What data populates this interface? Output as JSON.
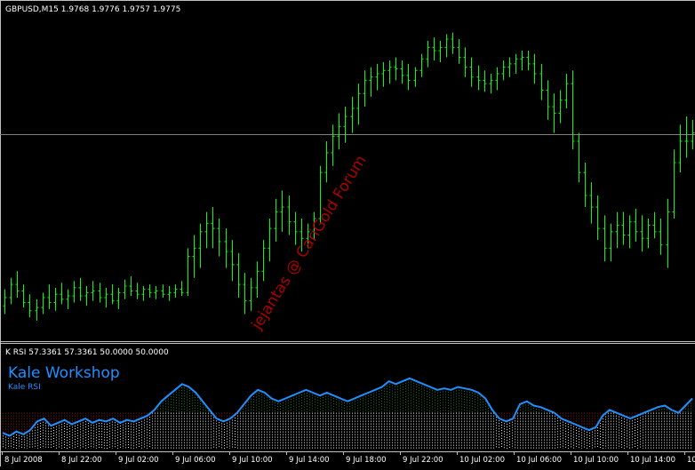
{
  "main_chart": {
    "header": "GBPUSD,M15  1.9768 1.9776 1.9757 1.9775",
    "watermark": "jejantas @ CariGold Forum",
    "bar_color": "#00ff00",
    "bid_line_color": "#808080",
    "ohlc_bars": [
      [
        1.9695,
        1.9705,
        1.969,
        1.97
      ],
      [
        1.97,
        1.9712,
        1.9696,
        1.9708
      ],
      [
        1.9708,
        1.9716,
        1.97,
        1.9704
      ],
      [
        1.9704,
        1.9708,
        1.9694,
        1.9697
      ],
      [
        1.9697,
        1.9702,
        1.9688,
        1.9692
      ],
      [
        1.9692,
        1.9699,
        1.9686,
        1.9694
      ],
      [
        1.9694,
        1.9703,
        1.969,
        1.97
      ],
      [
        1.97,
        1.9708,
        1.9693,
        1.9697
      ],
      [
        1.9697,
        1.9706,
        1.9692,
        1.9702
      ],
      [
        1.9702,
        1.9709,
        1.9696,
        1.9699
      ],
      [
        1.9699,
        1.9705,
        1.9693,
        1.9701
      ],
      [
        1.9701,
        1.971,
        1.9697,
        1.9706
      ],
      [
        1.9706,
        1.9712,
        1.9698,
        1.9701
      ],
      [
        1.9701,
        1.9707,
        1.9695,
        1.9703
      ],
      [
        1.9703,
        1.971,
        1.9698,
        1.9704
      ],
      [
        1.9704,
        1.9709,
        1.9697,
        1.97
      ],
      [
        1.97,
        1.9706,
        1.9694,
        1.9702
      ],
      [
        1.9702,
        1.9708,
        1.9696,
        1.9698
      ],
      [
        1.9698,
        1.9706,
        1.9693,
        1.9703
      ],
      [
        1.9703,
        1.9711,
        1.9699,
        1.9707
      ],
      [
        1.9707,
        1.9713,
        1.9701,
        1.9704
      ],
      [
        1.9704,
        1.9709,
        1.9699,
        1.9702
      ],
      [
        1.9702,
        1.9707,
        1.9698,
        1.9705
      ],
      [
        1.9705,
        1.9708,
        1.97,
        1.9703
      ],
      [
        1.9703,
        1.9707,
        1.9699,
        1.9704
      ],
      [
        1.9704,
        1.9708,
        1.97,
        1.9702
      ],
      [
        1.9702,
        1.9707,
        1.9698,
        1.9703
      ],
      [
        1.9703,
        1.9708,
        1.97,
        1.9705
      ],
      [
        1.9705,
        1.971,
        1.9701,
        1.9703
      ],
      [
        1.9703,
        1.973,
        1.9701,
        1.9725
      ],
      [
        1.9725,
        1.9738,
        1.9712,
        1.973
      ],
      [
        1.973,
        1.9745,
        1.9718,
        1.974
      ],
      [
        1.974,
        1.9752,
        1.973,
        1.9745
      ],
      [
        1.9745,
        1.9755,
        1.973,
        1.9742
      ],
      [
        1.9742,
        1.9748,
        1.9725,
        1.9734
      ],
      [
        1.9734,
        1.9742,
        1.9718,
        1.9728
      ],
      [
        1.9728,
        1.9735,
        1.971,
        1.972
      ],
      [
        1.972,
        1.9727,
        1.97,
        1.9708
      ],
      [
        1.9708,
        1.9715,
        1.969,
        1.9698
      ],
      [
        1.9698,
        1.9712,
        1.9692,
        1.9706
      ],
      [
        1.9706,
        1.9722,
        1.97,
        1.9716
      ],
      [
        1.9716,
        1.9735,
        1.971,
        1.973
      ],
      [
        1.973,
        1.9748,
        1.9722,
        1.9742
      ],
      [
        1.9742,
        1.976,
        1.9734,
        1.9752
      ],
      [
        1.9752,
        1.9765,
        1.974,
        1.9755
      ],
      [
        1.9755,
        1.9762,
        1.9738,
        1.9746
      ],
      [
        1.9746,
        1.9752,
        1.9732,
        1.974
      ],
      [
        1.974,
        1.9748,
        1.9728,
        1.9736
      ],
      [
        1.9736,
        1.9745,
        1.973,
        1.974
      ],
      [
        1.974,
        1.9752,
        1.9735,
        1.9748
      ],
      [
        1.9748,
        1.978,
        1.9745,
        1.9776
      ],
      [
        1.9776,
        1.9795,
        1.977,
        1.9788
      ],
      [
        1.9788,
        1.9805,
        1.978,
        1.9798
      ],
      [
        1.9798,
        1.9812,
        1.979,
        1.9804
      ],
      [
        1.9804,
        1.9816,
        1.9794,
        1.981
      ],
      [
        1.981,
        1.9822,
        1.98,
        1.9815
      ],
      [
        1.9815,
        1.983,
        1.9805,
        1.9824
      ],
      [
        1.9824,
        1.9838,
        1.9816,
        1.9832
      ],
      [
        1.9832,
        1.984,
        1.9822,
        1.9834
      ],
      [
        1.9834,
        1.9842,
        1.9826,
        1.9836
      ],
      [
        1.9836,
        1.9843,
        1.9828,
        1.9838
      ],
      [
        1.9838,
        1.9844,
        1.983,
        1.984
      ],
      [
        1.984,
        1.9846,
        1.9832,
        1.9839
      ],
      [
        1.9839,
        1.9844,
        1.983,
        1.9835
      ],
      [
        1.9835,
        1.9842,
        1.9826,
        1.9832
      ],
      [
        1.9832,
        1.984,
        1.9828,
        1.9838
      ],
      [
        1.9838,
        1.9848,
        1.9834,
        1.9845
      ],
      [
        1.9845,
        1.9856,
        1.984,
        1.9852
      ],
      [
        1.9852,
        1.9858,
        1.9844,
        1.985
      ],
      [
        1.985,
        1.9856,
        1.9843,
        1.9852
      ],
      [
        1.9852,
        1.986,
        1.9846,
        1.9857
      ],
      [
        1.9857,
        1.9861,
        1.9848,
        1.9852
      ],
      [
        1.9852,
        1.9857,
        1.9842,
        1.9846
      ],
      [
        1.9846,
        1.9852,
        1.9834,
        1.984
      ],
      [
        1.984,
        1.9846,
        1.9828,
        1.9834
      ],
      [
        1.9834,
        1.9841,
        1.9826,
        1.9832
      ],
      [
        1.9832,
        1.9838,
        1.9825,
        1.983
      ],
      [
        1.983,
        1.9836,
        1.9824,
        1.9832
      ],
      [
        1.9832,
        1.984,
        1.9826,
        1.9836
      ],
      [
        1.9836,
        1.9844,
        1.9832,
        1.984
      ],
      [
        1.984,
        1.9846,
        1.9834,
        1.9842
      ],
      [
        1.9842,
        1.9848,
        1.9836,
        1.9845
      ],
      [
        1.9845,
        1.985,
        1.9838,
        1.9846
      ],
      [
        1.9846,
        1.985,
        1.9838,
        1.9842
      ],
      [
        1.9842,
        1.9848,
        1.983,
        1.9836
      ],
      [
        1.9836,
        1.9842,
        1.982,
        1.9826
      ],
      [
        1.9826,
        1.9832,
        1.9808,
        1.9816
      ],
      [
        1.9816,
        1.9824,
        1.98,
        1.9812
      ],
      [
        1.9812,
        1.9826,
        1.9806,
        1.982
      ],
      [
        1.982,
        1.9836,
        1.9815,
        1.983
      ],
      [
        1.983,
        1.9838,
        1.979,
        1.9795
      ],
      [
        1.9795,
        1.98,
        1.977,
        1.9776
      ],
      [
        1.9776,
        1.9782,
        1.9755,
        1.9762
      ],
      [
        1.9762,
        1.977,
        1.9745,
        1.9755
      ],
      [
        1.9755,
        1.9762,
        1.9735,
        1.9742
      ],
      [
        1.9742,
        1.975,
        1.9722,
        1.973
      ],
      [
        1.973,
        1.9745,
        1.9722,
        1.974
      ],
      [
        1.974,
        1.9752,
        1.973,
        1.9744
      ],
      [
        1.9744,
        1.9752,
        1.9732,
        1.9738
      ],
      [
        1.9738,
        1.975,
        1.973,
        1.9746
      ],
      [
        1.9746,
        1.9754,
        1.9734,
        1.974
      ],
      [
        1.974,
        1.975,
        1.9728,
        1.9736
      ],
      [
        1.9736,
        1.9748,
        1.973,
        1.9744
      ],
      [
        1.9744,
        1.9752,
        1.9736,
        1.974
      ],
      [
        1.974,
        1.9748,
        1.9726,
        1.9732
      ],
      [
        1.9732,
        1.976,
        1.9718,
        1.9752
      ],
      [
        1.9752,
        1.979,
        1.9748,
        1.9782
      ],
      [
        1.9782,
        1.9805,
        1.9776,
        1.9795
      ],
      [
        1.9795,
        1.981,
        1.9785,
        1.9795
      ],
      [
        1.9795,
        1.9808,
        1.979,
        1.98
      ]
    ]
  },
  "indicator": {
    "header": "K RSI 57.3361 57.3361 50.0000 50.0000",
    "title": "Kale Workshop",
    "subtitle": "Kale RSI",
    "line_color": "#1e90ff",
    "upper_fill_color": "#1a7a1a",
    "lower_fill_color": "#8b1010",
    "base_dot_color": "#e6e6e6",
    "level": 50,
    "range": [
      25,
      90
    ],
    "rsi_values": [
      36,
      34,
      37,
      35,
      38,
      44,
      46,
      41,
      43,
      45,
      42,
      44,
      46,
      43,
      45,
      44,
      46,
      43,
      45,
      44,
      46,
      48,
      52,
      58,
      62,
      66,
      70,
      68,
      64,
      58,
      52,
      46,
      44,
      46,
      50,
      56,
      62,
      66,
      64,
      60,
      58,
      60,
      62,
      64,
      66,
      64,
      62,
      64,
      62,
      60,
      58,
      60,
      62,
      64,
      66,
      68,
      72,
      70,
      72,
      74,
      72,
      70,
      68,
      66,
      67,
      66,
      68,
      67,
      66,
      64,
      60,
      52,
      46,
      44,
      46,
      56,
      58,
      55,
      54,
      52,
      50,
      46,
      44,
      42,
      40,
      38,
      40,
      48,
      52,
      50,
      48,
      46,
      48,
      50,
      52,
      54,
      55,
      52,
      50,
      55,
      60
    ]
  },
  "time_axis": {
    "labels": [
      "8 Jul 2008",
      "8 Jul 22:00",
      "9 Jul 02:00",
      "9 Jul 06:00",
      "9 Jul 10:00",
      "9 Jul 14:00",
      "9 Jul 18:00",
      "9 Jul 22:00",
      "10 Jul 02:00",
      "10 Jul 06:00",
      "10 Jul 10:00",
      "10 Jul 14:00",
      "10"
    ]
  }
}
